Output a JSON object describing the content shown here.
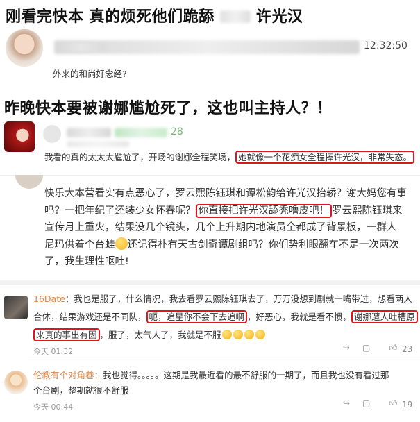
{
  "section1": {
    "headline_part1": "刚看完快本 真的烦死他们跪舔",
    "headline_part2": "许光汉",
    "timestamp": "12:32:50",
    "comment": "外来的和尚好念经?"
  },
  "section2": {
    "headline": "昨晚快本要被谢娜尴尬死了，这也叫主持人？！",
    "count": "28",
    "comment_part1": "我看的真的太太太尴尬了，开场的谢娜全程笑场，",
    "comment_highlight": "她就像一个花痴女全程捧许光汉，非常失态。"
  },
  "post": {
    "line1": "快乐大本营看实有点恶心了，罗云熙陈钰琪和谭松韵给许光汉抬轿？谢大妈您有事",
    "line2": "吗？一把年纪了还装少女怀春呢？",
    "line2_highlight": "你直接把许光汉舔秃噜皮吧！",
    "line2_tail": "罗云熙陈钰琪来",
    "line3": "宣传月上重火，结果没几个镜头，几个上升期内地演员全都成了背景板，一群人",
    "line4_a": "尼玛供着个台蛙",
    "line4_b": "还记得朴有天古剑奇谭剧组吗？你们势利眼翻车不是一次两次",
    "line5": "了，我生理性呕吐!"
  },
  "comment1": {
    "username": "16Date",
    "line1": "：我也是服了，什么情况，我去看罗云熙陈钰琪去了，万万没想到剧就一嘴带过，想看两人",
    "line2_a": "合体，结果游戏还是不同队，",
    "line2_hl1": "呃，追星你不会下去追啊",
    "line2_b": "，好恶心，我就是看不惯，",
    "line2_hl2": "谢娜遭人吐槽原",
    "line3_hl": "来真的事出有因",
    "line3_b": "，服了，太气人了，我就是不服",
    "time": "今天 01:32",
    "likes": "23"
  },
  "comment2": {
    "username": "伦教有个对角巷",
    "line1": "：我也觉得。。。。。这期是我最近看的最不舒服的一期了，而且我也没有看过那",
    "line2": "个台剧，整期就很不舒服",
    "time": "今天 00:44",
    "likes": "19"
  },
  "icons": [
    "avatar",
    "share-icon",
    "reply-icon",
    "thumbs-up-icon",
    "emoji-icon"
  ],
  "colors": {
    "highlight_border": "#e0161d",
    "username": "#e08a4a",
    "count": "#7ab87a"
  }
}
